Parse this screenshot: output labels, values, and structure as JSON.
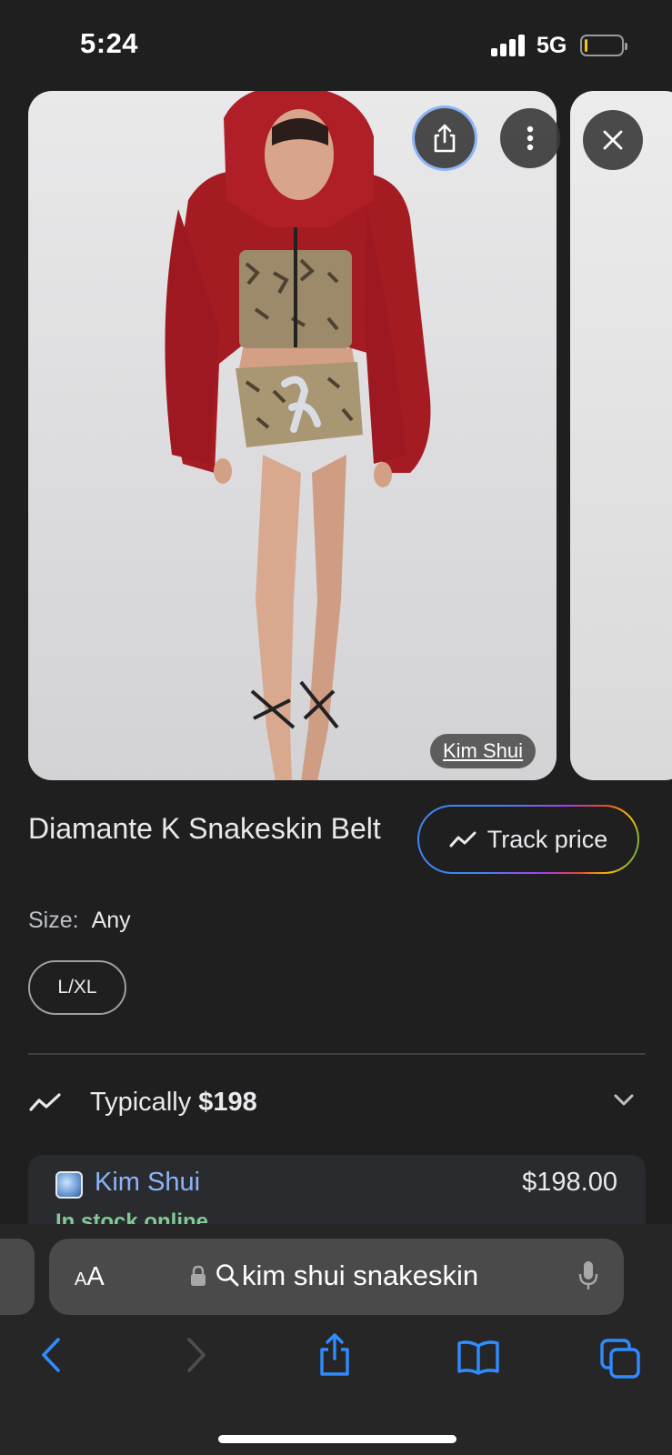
{
  "status_bar": {
    "time": "5:24",
    "network": "5G",
    "signal_bars": 4,
    "battery_level": 0.08,
    "battery_color": "#f5c518"
  },
  "image": {
    "source_label": "Kim Shui",
    "icons": [
      "share-icon",
      "more-vert-icon",
      "close-icon"
    ]
  },
  "product": {
    "title": "Diamante K Snakeskin Belt",
    "track_label": "Track price",
    "size_label": "Size:",
    "size_value": "Any",
    "size_chip": "L/XL"
  },
  "price_summary": {
    "prefix": "Typically",
    "amount": "$198"
  },
  "offer": {
    "merchant": "Kim Shui",
    "price": "$198.00",
    "stock": "In stock online"
  },
  "browser": {
    "aa_small": "A",
    "aa_big": "A",
    "address_text": "kim shui snakeskin",
    "accent": "#2f8cff"
  }
}
